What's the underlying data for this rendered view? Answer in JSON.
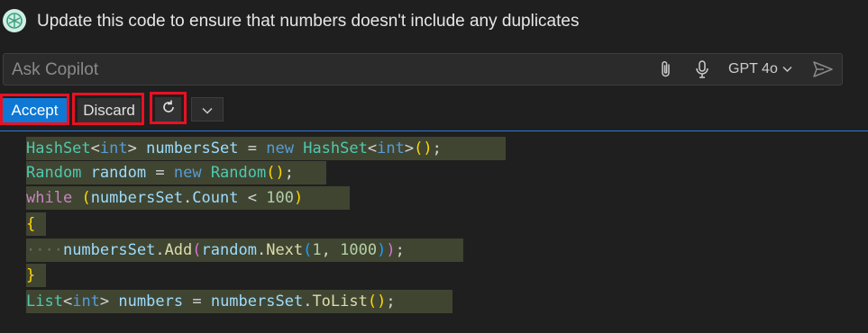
{
  "prompt": {
    "text": "Update this code to ensure that numbers doesn't include any duplicates"
  },
  "ask": {
    "placeholder": "Ask Copilot",
    "model": "GPT 4o"
  },
  "actions": {
    "accept": "Accept",
    "discard": "Discard"
  },
  "icons": {
    "avatar": "copilot-avatar-icon",
    "attach": "paperclip-icon",
    "mic": "microphone-icon",
    "model_dropdown": "chevron-down-icon",
    "send": "send-icon",
    "redo": "refresh-icon",
    "more": "chevron-down-icon"
  },
  "colors": {
    "accent": "#0e78d4",
    "highlight_frame": "#e81123",
    "diff_background": "#404532",
    "editor_background": "#1f1f1f"
  },
  "code": {
    "lines": [
      "HashSet<int> numbersSet = new HashSet<int>();",
      "Random random = new Random();",
      "while (numbersSet.Count < 100)",
      "{",
      "    numbersSet.Add(random.Next(1, 1000));",
      "}",
      "List<int> numbers = numbersSet.ToList();"
    ]
  }
}
